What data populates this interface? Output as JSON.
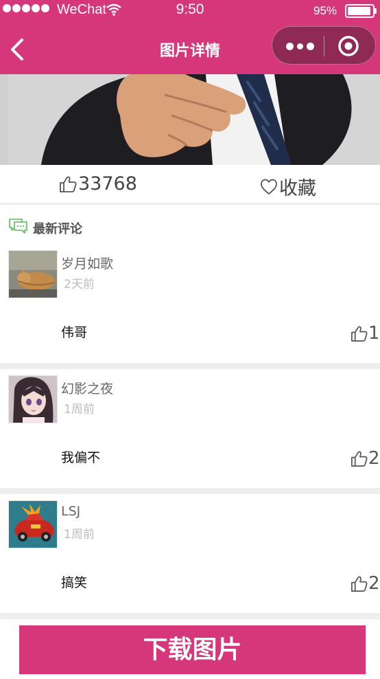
{
  "status_bar": {
    "carrier": "WeChat",
    "time": "9:50",
    "battery": "95%",
    "battery_level": 0.95
  },
  "nav": {
    "title": "图片详情"
  },
  "stats": {
    "likes": "33768",
    "favorite_label": "收藏"
  },
  "section": {
    "title": "最新评论"
  },
  "comments": [
    {
      "user": "岁月如歌",
      "time": "2天前",
      "text": "伟哥",
      "likes": "1"
    },
    {
      "user": "幻影之夜",
      "time": "1周前",
      "text": "我偏不",
      "likes": "2"
    },
    {
      "user": "LSJ",
      "time": "1周前",
      "text": "搞笑",
      "likes": "2"
    }
  ],
  "download": {
    "label": "下载图片"
  },
  "colors": {
    "brand": "#d6377a",
    "capsule": "#8f2a55",
    "comment_icon": "#5cb85c"
  }
}
